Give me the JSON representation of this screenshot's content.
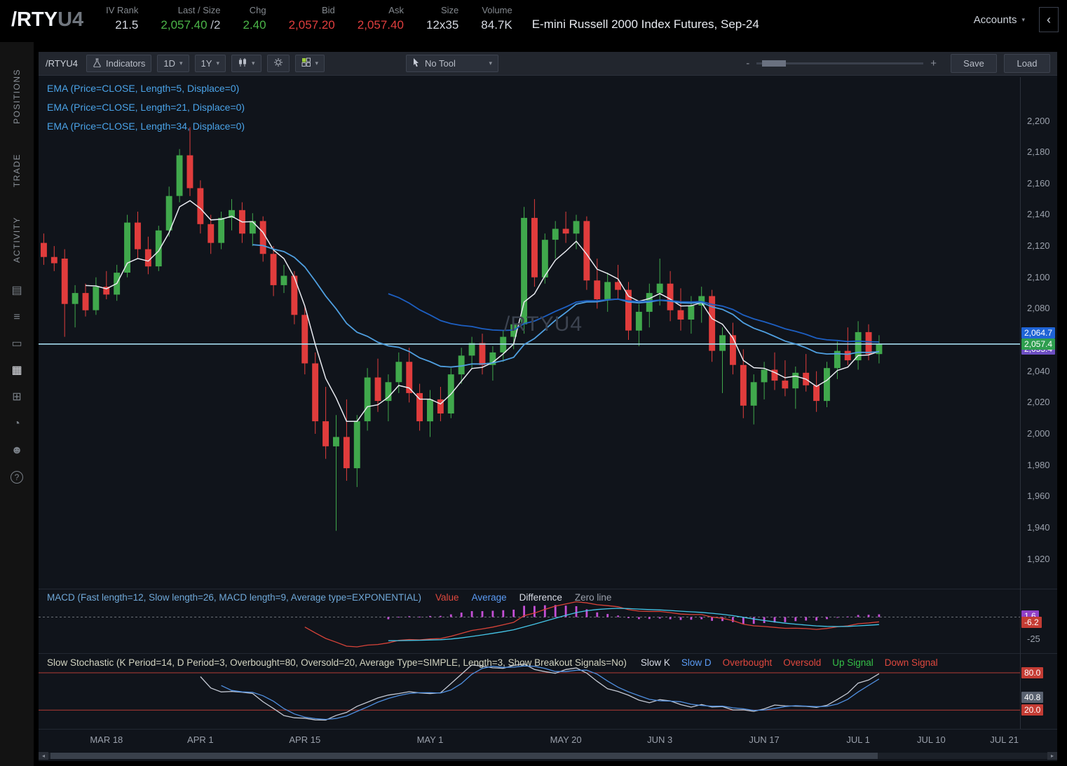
{
  "theme": {
    "up_green": "#4bb648",
    "down_red": "#e03e3e",
    "accent_blue": "#4aa3e8",
    "axis_text": "#9aa0ab",
    "panel_bg": "#10141b"
  },
  "ui": {
    "chevron_down": "▾",
    "collapse_glyph": "‹",
    "scroll_left": "◂",
    "scroll_right": "▸",
    "zoom_minus": "-",
    "zoom_plus": "+"
  },
  "header": {
    "symbol_root": "/RTY",
    "symbol_suffix": "U4",
    "fields": [
      {
        "label": "IV Rank",
        "value": "21.5"
      },
      {
        "label": "Last / Size",
        "value": "2,057.40",
        "value2": " /2"
      },
      {
        "label": "Chg",
        "value": "2.40"
      },
      {
        "label": "Bid",
        "value": "2,057.20"
      },
      {
        "label": "Ask",
        "value": "2,057.40"
      },
      {
        "label": "Size",
        "value": "12x35"
      },
      {
        "label": "Volume",
        "value": "84.7K"
      }
    ],
    "description": "E-mini Russell 2000 Index Futures, Sep-24",
    "accounts_label": "Accounts"
  },
  "sidebar": {
    "tabs": [
      {
        "label": "POSITIONS"
      },
      {
        "label": "TRADE"
      },
      {
        "label": "ACTIVITY"
      }
    ],
    "icons": [
      {
        "name": "monitor-icon",
        "glyph": "▤"
      },
      {
        "name": "order-list-icon",
        "glyph": "≡"
      },
      {
        "name": "trade-ticket-icon",
        "glyph": "▭"
      },
      {
        "name": "chart-grid-icon",
        "glyph": "▦",
        "active": true
      },
      {
        "name": "widgets-icon",
        "glyph": "⊞"
      },
      {
        "name": "history-icon",
        "glyph": "◔"
      },
      {
        "name": "community-icon",
        "glyph": "☻"
      },
      {
        "name": "help-icon",
        "glyph": "?"
      }
    ]
  },
  "toolbar": {
    "symbol_label": "/RTYU4",
    "indicators_label": "Indicators",
    "aggregation_value": "1D",
    "range_value": "1Y",
    "tool_value": "No Tool",
    "save_label": "Save",
    "load_label": "Load"
  },
  "chart_data": {
    "type": "candlestick",
    "symbol": "/RTYU4",
    "watermark": "/RTYU4",
    "last_price": 2057.4,
    "slots": 94,
    "up_color": "#40a84c",
    "down_color": "#e03c3c",
    "price_line": {
      "value": 2057.4,
      "color": "#a5dcef"
    },
    "price_axis": {
      "min": 1901,
      "max": 2228,
      "ticks": [
        {
          "text": "2,200",
          "value": 2200
        },
        {
          "text": "2,180",
          "value": 2180
        },
        {
          "text": "2,160",
          "value": 2160
        },
        {
          "text": "2,140",
          "value": 2140
        },
        {
          "text": "2,120",
          "value": 2120
        },
        {
          "text": "2,100",
          "value": 2100
        },
        {
          "text": "2,080",
          "value": 2080
        },
        {
          "text": "2,060",
          "value": 2060
        },
        {
          "text": "2,040",
          "value": 2040
        },
        {
          "text": "2,020",
          "value": 2020
        },
        {
          "text": "2,000",
          "value": 2000
        },
        {
          "text": "1,980",
          "value": 1980
        },
        {
          "text": "1,960",
          "value": 1960
        },
        {
          "text": "1,940",
          "value": 1940
        },
        {
          "text": "1,920",
          "value": 1920
        }
      ]
    },
    "badges": [
      {
        "text": "2,064.7",
        "value": 2064.7,
        "bg": "#1f64d6"
      },
      {
        "text": "2,055.4",
        "value": 2054.2,
        "bg": "#6d4fc2"
      },
      {
        "text": "2,057.4",
        "value": 2057.4,
        "bg": "#2e9e4f"
      }
    ],
    "x_axis": [
      {
        "label": "MAR 18",
        "idx": 6
      },
      {
        "label": "APR 1",
        "idx": 15
      },
      {
        "label": "APR 15",
        "idx": 25
      },
      {
        "label": "MAY 1",
        "idx": 37
      },
      {
        "label": "MAY 20",
        "idx": 50
      },
      {
        "label": "JUN 3",
        "idx": 59
      },
      {
        "label": "JUN 17",
        "idx": 69
      },
      {
        "label": "JUL 1",
        "idx": 78
      },
      {
        "label": "JUL 10",
        "idx": 85
      },
      {
        "label": "JUL 21",
        "idx": 92
      }
    ],
    "overlays": [
      {
        "label": "EMA (Price=CLOSE, Length=5, Displace=0)",
        "length": 5,
        "color": "#e8eaf0",
        "width": 1.5
      },
      {
        "label": "EMA (Price=CLOSE, Length=21, Displace=0)",
        "length": 21,
        "color": "#4f9fe0",
        "width": 1.8
      },
      {
        "label": "EMA (Price=CLOSE, Length=34, Displace=0)",
        "length": 34,
        "color": "#1d5fc2",
        "width": 1.8
      }
    ],
    "ohlc": [
      [
        2122,
        2128,
        2108,
        2113
      ],
      [
        2113,
        2120,
        2104,
        2109
      ],
      [
        2112,
        2118,
        2062,
        2083
      ],
      [
        2083,
        2095,
        2068,
        2090
      ],
      [
        2090,
        2096,
        2075,
        2079
      ],
      [
        2079,
        2100,
        2076,
        2094
      ],
      [
        2094,
        2104,
        2086,
        2089
      ],
      [
        2089,
        2108,
        2085,
        2103
      ],
      [
        2103,
        2140,
        2100,
        2135
      ],
      [
        2135,
        2142,
        2112,
        2118
      ],
      [
        2118,
        2126,
        2102,
        2107
      ],
      [
        2107,
        2133,
        2104,
        2130
      ],
      [
        2130,
        2158,
        2126,
        2152
      ],
      [
        2152,
        2182,
        2148,
        2178
      ],
      [
        2178,
        2196,
        2152,
        2157
      ],
      [
        2157,
        2162,
        2128,
        2134
      ],
      [
        2134,
        2140,
        2115,
        2122
      ],
      [
        2122,
        2142,
        2118,
        2138
      ],
      [
        2138,
        2150,
        2130,
        2143
      ],
      [
        2143,
        2148,
        2122,
        2128
      ],
      [
        2128,
        2141,
        2120,
        2136
      ],
      [
        2136,
        2139,
        2110,
        2115
      ],
      [
        2115,
        2120,
        2088,
        2095
      ],
      [
        2095,
        2108,
        2090,
        2101
      ],
      [
        2101,
        2104,
        2070,
        2076
      ],
      [
        2076,
        2082,
        2038,
        2045
      ],
      [
        2045,
        2052,
        2000,
        2008
      ],
      [
        2008,
        2030,
        1984,
        1992
      ],
      [
        1992,
        2012,
        1938,
        1998
      ],
      [
        1998,
        2022,
        1970,
        1978
      ],
      [
        1978,
        2012,
        1966,
        2008
      ],
      [
        2008,
        2042,
        2002,
        2036
      ],
      [
        2036,
        2048,
        2014,
        2021
      ],
      [
        2021,
        2038,
        2008,
        2033
      ],
      [
        2033,
        2052,
        2026,
        2046
      ],
      [
        2046,
        2055,
        2020,
        2026
      ],
      [
        2026,
        2032,
        2002,
        2008
      ],
      [
        2008,
        2028,
        1998,
        2022
      ],
      [
        2022,
        2030,
        2008,
        2013
      ],
      [
        2013,
        2042,
        2010,
        2038
      ],
      [
        2038,
        2055,
        2032,
        2050
      ],
      [
        2050,
        2062,
        2042,
        2058
      ],
      [
        2058,
        2064,
        2038,
        2044
      ],
      [
        2044,
        2056,
        2034,
        2052
      ],
      [
        2052,
        2066,
        2046,
        2062
      ],
      [
        2062,
        2075,
        2054,
        2070
      ],
      [
        2070,
        2145,
        2064,
        2138
      ],
      [
        2138,
        2150,
        2094,
        2100
      ],
      [
        2100,
        2128,
        2096,
        2124
      ],
      [
        2124,
        2136,
        2112,
        2131
      ],
      [
        2131,
        2142,
        2122,
        2128
      ],
      [
        2128,
        2140,
        2118,
        2136
      ],
      [
        2136,
        2139,
        2092,
        2098
      ],
      [
        2098,
        2112,
        2080,
        2086
      ],
      [
        2086,
        2103,
        2078,
        2097
      ],
      [
        2097,
        2108,
        2086,
        2092
      ],
      [
        2092,
        2097,
        2060,
        2066
      ],
      [
        2066,
        2083,
        2056,
        2078
      ],
      [
        2078,
        2096,
        2068,
        2090
      ],
      [
        2090,
        2112,
        2082,
        2096
      ],
      [
        2096,
        2104,
        2072,
        2079
      ],
      [
        2079,
        2093,
        2066,
        2073
      ],
      [
        2073,
        2088,
        2064,
        2082
      ],
      [
        2082,
        2094,
        2071,
        2088
      ],
      [
        2088,
        2092,
        2046,
        2053
      ],
      [
        2053,
        2068,
        2026,
        2063
      ],
      [
        2063,
        2071,
        2038,
        2044
      ],
      [
        2044,
        2054,
        2010,
        2018
      ],
      [
        2018,
        2038,
        2006,
        2033
      ],
      [
        2033,
        2046,
        2022,
        2041
      ],
      [
        2041,
        2052,
        2028,
        2034
      ],
      [
        2034,
        2047,
        2024,
        2029
      ],
      [
        2029,
        2043,
        2016,
        2039
      ],
      [
        2039,
        2051,
        2027,
        2031
      ],
      [
        2031,
        2040,
        2014,
        2021
      ],
      [
        2021,
        2046,
        2017,
        2042
      ],
      [
        2042,
        2059,
        2035,
        2053
      ],
      [
        2053,
        2068,
        2044,
        2047
      ],
      [
        2047,
        2072,
        2041,
        2065
      ],
      [
        2065,
        2070,
        2047,
        2051
      ],
      [
        2051,
        2063,
        2045,
        2057.4
      ]
    ],
    "macd": {
      "title": "MACD (Fast length=12, Slow length=26, MACD length=9, Average type=EXPONENTIAL)",
      "title_color": "#6fa8d8",
      "legend": [
        {
          "text": "Value",
          "color": "#e0483e"
        },
        {
          "text": "Average",
          "color": "#5b9cf6"
        },
        {
          "text": "Difference",
          "color": "#d8dce6"
        },
        {
          "text": "Zero line",
          "color": "#9aa0ab"
        }
      ],
      "fast": 12,
      "slow": 26,
      "signal": 9,
      "range": [
        30,
        -38
      ],
      "value_color": "#d84339",
      "avg_color": "#45c6e8",
      "diff_color": "#c44fd6",
      "zero_color": "#6a7077",
      "badges": [
        {
          "text": "1.6",
          "value": 1.6,
          "bg": "#9041c8"
        },
        {
          "text": "-6.2",
          "value": -6.2,
          "bg": "#c43c34"
        }
      ],
      "axis_tick": {
        "text": "-25",
        "value": -25
      }
    },
    "stoch": {
      "title": "Slow Stochastic (K Period=14, D Period=3, Overbought=80, Oversold=20, Average Type=SIMPLE, Length=3, Show Breakout Signals=No)",
      "title_color": "#d2d4c0",
      "legend": [
        {
          "text": "Slow K",
          "color": "#d8dce6"
        },
        {
          "text": "Slow D",
          "color": "#5b9cf6"
        },
        {
          "text": "Overbought",
          "color": "#e0483e"
        },
        {
          "text": "Oversold",
          "color": "#e0483e"
        },
        {
          "text": "Up Signal",
          "color": "#35c048"
        },
        {
          "text": "Down Signal",
          "color": "#e0483e"
        }
      ],
      "k_period": 14,
      "d_period": 3,
      "smoothing": 3,
      "overbought": 80,
      "oversold": 20,
      "range": [
        107,
        -10
      ],
      "k_color": "#c4c9d4",
      "d_color": "#4f8fe0",
      "level_color": "#b23b34",
      "badges": [
        {
          "text": "80.0",
          "value": 80,
          "bg": "#c43c34"
        },
        {
          "text": "40.8",
          "value": 40.8,
          "bg": "#5a6270"
        },
        {
          "text": "20.0",
          "value": 20,
          "bg": "#c43c34"
        }
      ]
    }
  }
}
